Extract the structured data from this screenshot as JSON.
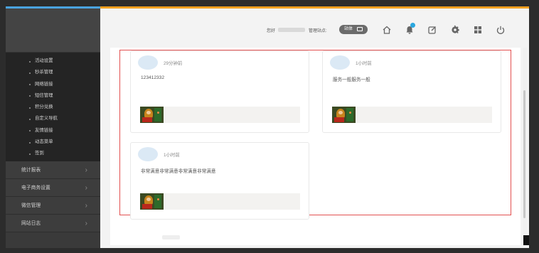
{
  "header": {
    "greeting": "您好",
    "admin_label": "管理站点:",
    "view_button": "站体"
  },
  "sidebar": {
    "subitems": [
      {
        "label": "活动设置"
      },
      {
        "label": "秒杀管理"
      },
      {
        "label": "网络链接"
      },
      {
        "label": "短信管理"
      },
      {
        "label": "积分兑换"
      },
      {
        "label": "自定义导航"
      },
      {
        "label": "友情链接"
      },
      {
        "label": "动态菜单"
      },
      {
        "label": "签到"
      }
    ],
    "menu": [
      {
        "label": "统计报表"
      },
      {
        "label": "电子商务设置"
      },
      {
        "label": "微信管理"
      },
      {
        "label": "网站日志"
      }
    ]
  },
  "posts": [
    {
      "time": "29分钟前",
      "content": "123412332"
    },
    {
      "time": "1小时前",
      "content": "服务一般服务一般"
    },
    {
      "time": "1小时前",
      "content": "非常满意非常满意非常满意非常满意"
    }
  ],
  "colors": {
    "accent_orange": "#f0a020",
    "accent_blue": "#4aa3df",
    "highlight_border": "#e35050",
    "badge": "#2aa7df",
    "sidebar_bg": "#3a3a3a"
  },
  "icons": [
    "home-icon",
    "bell-icon",
    "edit-icon",
    "gear-icon",
    "grid-icon",
    "power-icon",
    "monitor-icon",
    "chevron-right-icon"
  ]
}
